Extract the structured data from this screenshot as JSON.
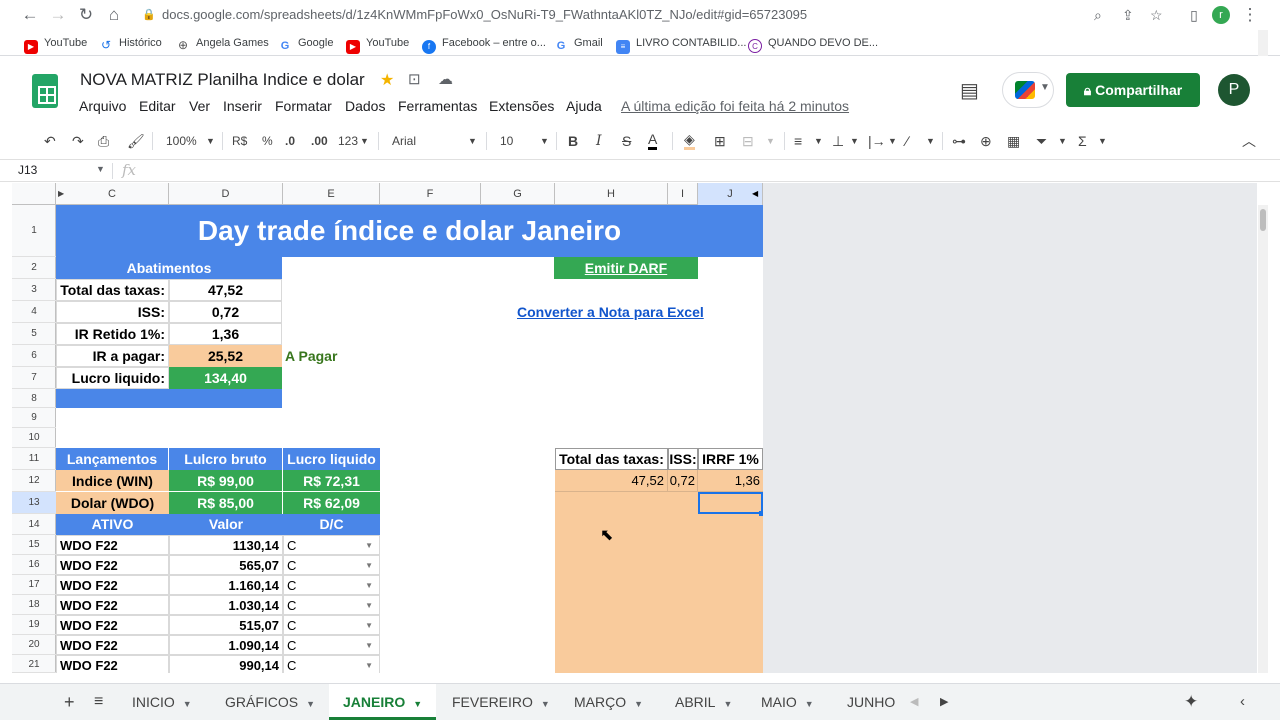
{
  "browser": {
    "url": "docs.google.com/spreadsheets/d/1z4KnWMmFpFoWx0_OsNuRi-T9_FWathntaAKl0TZ_NJo/edit#gid=65723095",
    "profile_initial": "r",
    "bookmarks": [
      "YouTube",
      "Histórico",
      "Angela Games",
      "Google",
      "YouTube",
      "Facebook – entre o...",
      "Gmail",
      "LIVRO CONTABILID...",
      "QUANDO DEVO DE..."
    ]
  },
  "doc": {
    "title": "NOVA MATRIZ Planilha Indice e dolar",
    "menus": [
      "Arquivo",
      "Editar",
      "Ver",
      "Inserir",
      "Formatar",
      "Dados",
      "Ferramentas",
      "Extensões",
      "Ajuda"
    ],
    "last_edit": "A última edição foi feita há 2 minutos",
    "share_label": "Compartilhar",
    "avatar_initial": "P"
  },
  "toolbar": {
    "zoom": "100%",
    "currency": "R$",
    "percent": "%",
    "dec_less": ".0",
    "dec_more": ".00",
    "number_format": "123",
    "font": "Arial",
    "font_size": "10"
  },
  "formula_bar": {
    "cell_ref": "J13",
    "fx": "fx"
  },
  "columns": [
    "C",
    "D",
    "E",
    "F",
    "G",
    "H",
    "I",
    "J"
  ],
  "rows": [
    "1",
    "2",
    "3",
    "4",
    "5",
    "6",
    "7",
    "8",
    "9",
    "10",
    "11",
    "12",
    "13",
    "14",
    "15",
    "16",
    "17",
    "18",
    "19",
    "20",
    "21"
  ],
  "sheet": {
    "title": "Day trade índice e dolar Janeiro",
    "abatimentos": {
      "header": "Abatimentos",
      "rows": [
        {
          "label": "Total das taxas:",
          "value": "47,52"
        },
        {
          "label": "ISS:",
          "value": "0,72"
        },
        {
          "label": "IR Retido 1%:",
          "value": "1,36"
        },
        {
          "label": "IR a pagar:",
          "value": "25,52"
        },
        {
          "label": "Lucro liquido:",
          "value": "134,40"
        }
      ],
      "status": "A Pagar"
    },
    "emitir_darf": "Emitir DARF",
    "converter_nota": "Converter a Nota para Excel",
    "lancamentos": {
      "headers": [
        "Lançamentos",
        "Lulcro bruto",
        "Lucro liquido"
      ],
      "rows": [
        {
          "ativo": "Indice (WIN)",
          "bruto": "R$ 99,00",
          "liquido": "R$ 72,31"
        },
        {
          "ativo": "Dolar (WDO)",
          "bruto": "R$ 85,00",
          "liquido": "R$ 62,09"
        }
      ]
    },
    "trades": {
      "headers": [
        "ATIVO",
        "Valor",
        "D/C"
      ],
      "rows": [
        {
          "ativo": "WDO F22",
          "valor": "1130,14",
          "dc": "C"
        },
        {
          "ativo": "WDO F22",
          "valor": "565,07",
          "dc": "C"
        },
        {
          "ativo": "WDO F22",
          "valor": "1.160,14",
          "dc": "C"
        },
        {
          "ativo": "WDO F22",
          "valor": "1.030,14",
          "dc": "C"
        },
        {
          "ativo": "WDO F22",
          "valor": "515,07",
          "dc": "C"
        },
        {
          "ativo": "WDO F22",
          "valor": "1.090,14",
          "dc": "C"
        },
        {
          "ativo": "WDO F22",
          "valor": "990,14",
          "dc": "C"
        }
      ]
    },
    "taxas_table": {
      "headers": [
        "Total das taxas:",
        "ISS:",
        "IRRF 1%"
      ],
      "values": [
        "47,52",
        "0,72",
        "1,36"
      ]
    }
  },
  "tabs": [
    "INICIO",
    "GRÁFICOS",
    "JANEIRO",
    "FEVEREIRO",
    "MARÇO",
    "ABRIL",
    "MAIO",
    "JUNHO"
  ],
  "active_tab": "JANEIRO"
}
